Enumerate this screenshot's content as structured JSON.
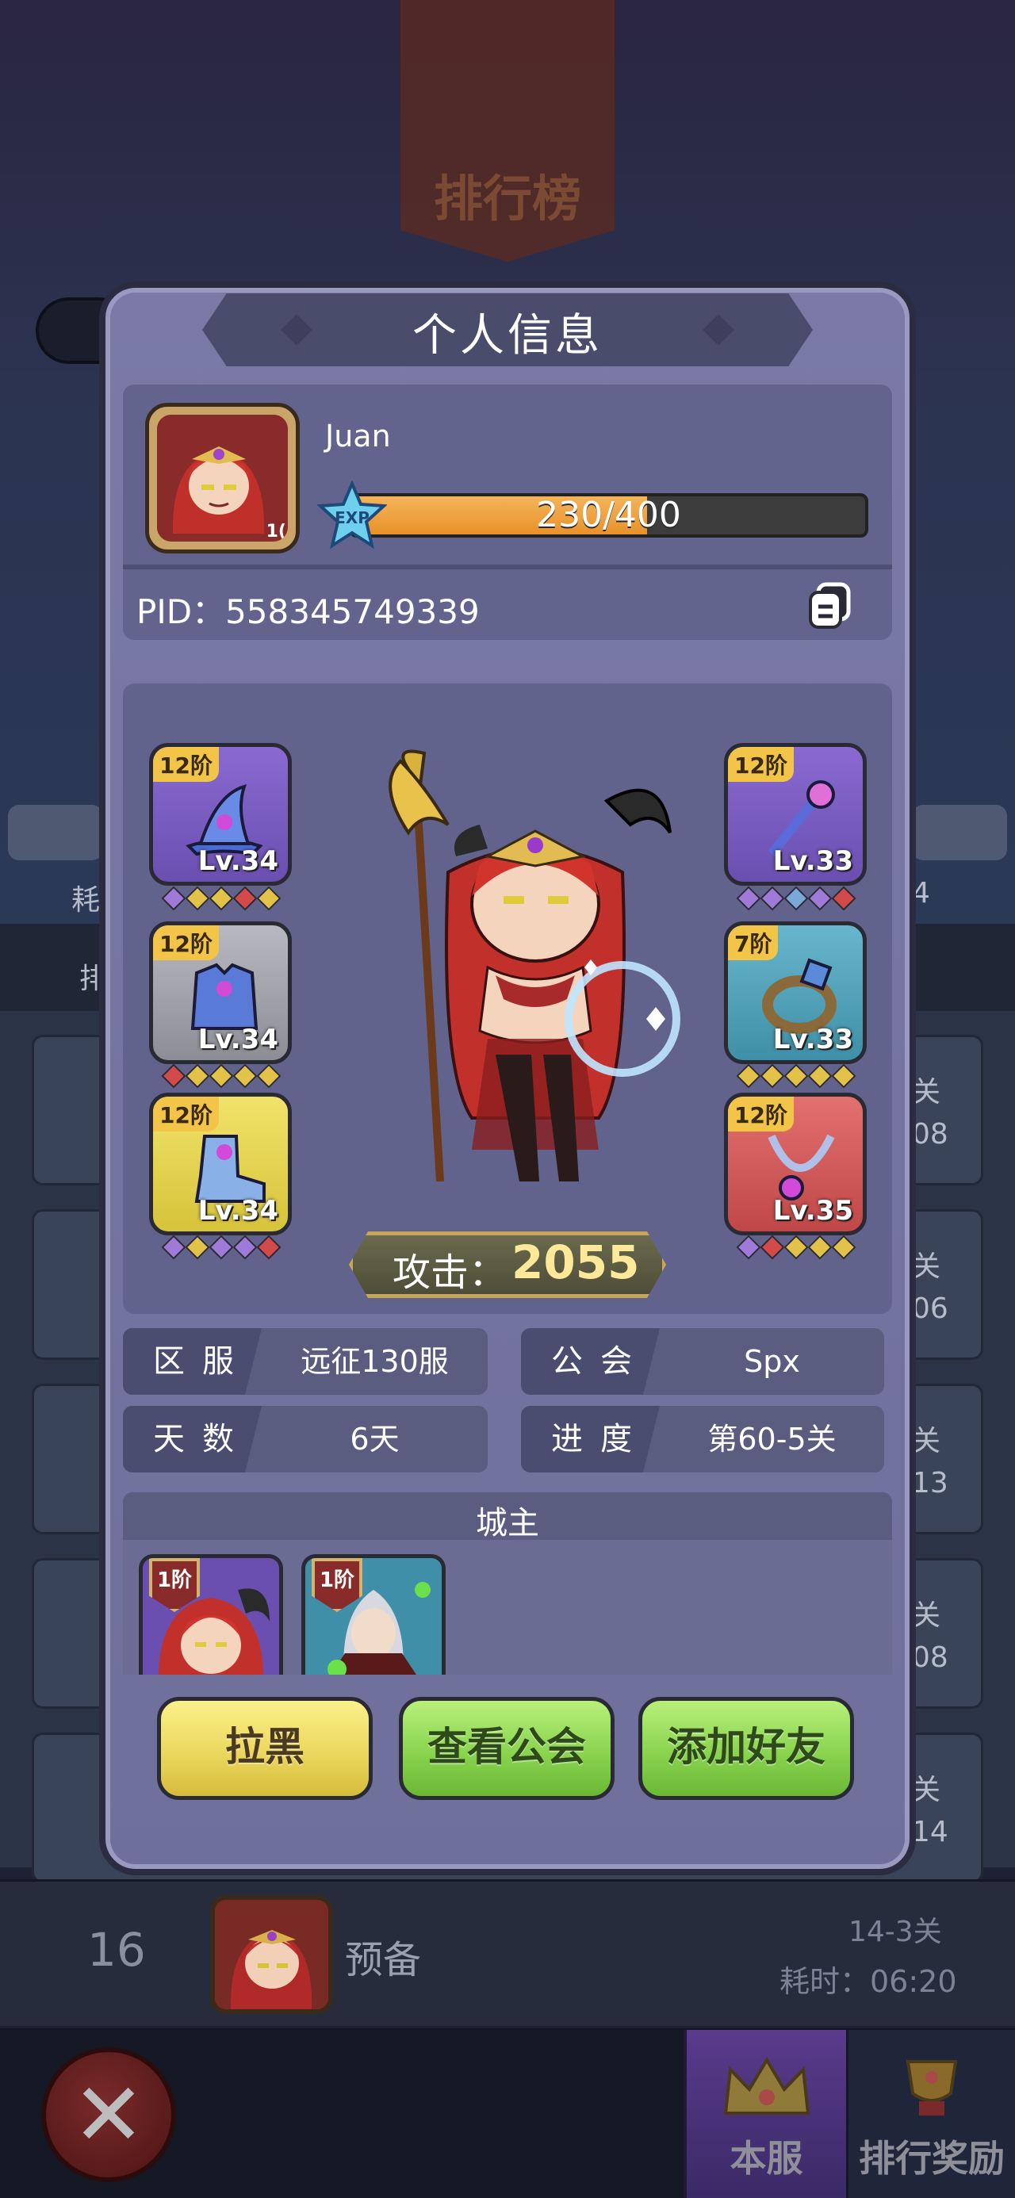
{
  "background": {
    "banner_title": "排行榜",
    "left_partial_1": "耗",
    "left_partial_2": "排",
    "right_partial_num": "4",
    "rows_right": [
      {
        "stage": "关",
        "time": "08"
      },
      {
        "stage": "关",
        "time": "06"
      },
      {
        "stage": "关",
        "time": "13"
      },
      {
        "stage": "关",
        "time": "08"
      },
      {
        "stage": "关",
        "time": "14"
      }
    ],
    "bottom_rank": {
      "rank": "16",
      "name": "预备",
      "stage": "14-3关",
      "time": "耗时：06:20"
    },
    "tabs": {
      "server": "本服",
      "reward": "排行奖励"
    }
  },
  "modal": {
    "title": "个人信息",
    "player": {
      "name": "Juan",
      "avatar_level": "1(",
      "exp_label": "EXP",
      "exp_text": "230/400",
      "exp_progress": 0.575,
      "pid_label": "PID：",
      "pid_value": "558345749339"
    },
    "equipment": {
      "left": [
        {
          "tier": "12阶",
          "level": "Lv.34",
          "type": "wizard-hat",
          "gems": [
            "#a07ad8",
            "#e3c24a",
            "#e3c24a",
            "#d24a4a",
            "#e3c24a"
          ]
        },
        {
          "tier": "12阶",
          "level": "Lv.34",
          "type": "armor",
          "gems": [
            "#d24a4a",
            "#e3c24a",
            "#e3c24a",
            "#e3c24a",
            "#e3c24a"
          ]
        },
        {
          "tier": "12阶",
          "level": "Lv.34",
          "type": "boots",
          "gems": [
            "#a07ad8",
            "#e3c24a",
            "#a07ad8",
            "#a07ad8",
            "#d24a4a"
          ]
        }
      ],
      "right": [
        {
          "tier": "12阶",
          "level": "Lv.33",
          "type": "staff",
          "gems": [
            "#a07ad8",
            "#a07ad8",
            "#7aa8d8",
            "#a07ad8",
            "#d24a4a"
          ]
        },
        {
          "tier": "7阶",
          "level": "Lv.33",
          "type": "ring",
          "gems": [
            "#e3c24a",
            "#e3c24a",
            "#e3c24a",
            "#e3c24a",
            "#e3c24a"
          ]
        },
        {
          "tier": "12阶",
          "level": "Lv.35",
          "type": "necklace",
          "gems": [
            "#a07ad8",
            "#d24a4a",
            "#e3c24a",
            "#e3c24a",
            "#e3c24a"
          ]
        }
      ]
    },
    "attack": {
      "label": "攻击：",
      "value": "2055"
    },
    "info": {
      "server_label": "区服",
      "server_value": "远征130服",
      "guild_label": "公会",
      "guild_value": "Spx",
      "days_label": "天数",
      "days_value": "6天",
      "progress_label": "进度",
      "progress_value": "第60-5关"
    },
    "lord": {
      "title": "城主",
      "heroes": [
        {
          "tier": "1阶",
          "color": "#6a4fb0"
        },
        {
          "tier": "1阶",
          "color": "#3f8fa8"
        }
      ]
    },
    "buttons": {
      "block": "拉黑",
      "view_guild": "查看公会",
      "add_friend": "添加好友"
    }
  }
}
